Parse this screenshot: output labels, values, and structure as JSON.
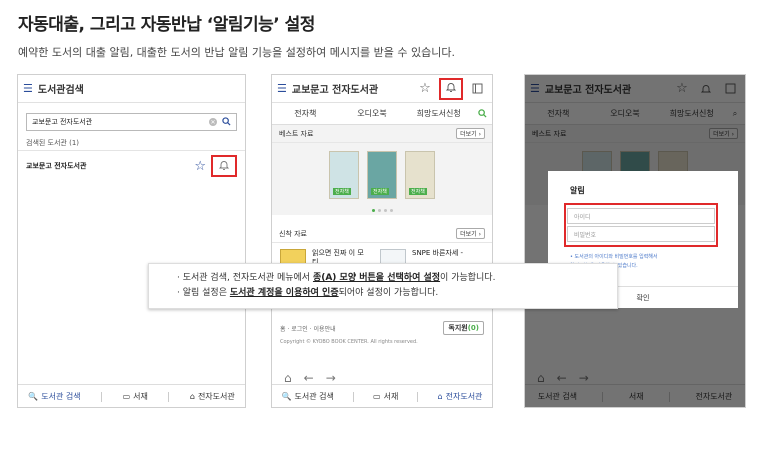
{
  "heading": {
    "title": "자동대출, 그리고 자동반납 ‘알림기능’ 설정",
    "subtitle": "예약한 도서의 대출 알림, 대출한 도서의 반납 알림 기능을 설정하여 메시지를 받을 수 있습니다."
  },
  "panel1": {
    "header_title": "도서관검색",
    "search_value": "교보문고 전자도서관",
    "searched_label": "검색된 도서관 (1)",
    "library_name": "교보문고 전자도서관"
  },
  "panel2": {
    "header_title": "교보문고 전자도서관",
    "tabs": [
      "전자책",
      "오디오북",
      "희망도서신청"
    ],
    "best_label": "베스트 자료",
    "new_label": "신착 자료",
    "more_label": "더보기 ›",
    "ebook_tag": "전자책",
    "new_book1": "읽으면 진짜 이 모티...",
    "new_book2": "SNPE 바른자세 -",
    "home_login": "홈 · 로그인 · 이용안내",
    "support_label": "독지원",
    "support_suffix": "(0)",
    "copyright": "Copyright © KYOBO BOOK CENTER. All rights reserved."
  },
  "panel3": {
    "dialog_title": "알림",
    "id_placeholder": "아이디",
    "pw_placeholder": "비밀번호",
    "dialog_note": "• 도서관의 아이디와 비밀번호를 입력해서",
    "dialog_note2": "   알림 기능을 사용할 수 있습니다.",
    "confirm_label": "확인"
  },
  "footer": {
    "search_label": "도서관 검색",
    "library_label": "서재",
    "ebook_library_label": "전자도서관"
  },
  "callout": {
    "line1_prefix": "· 도서관 검색, 전자도서관 메뉴에서 ",
    "line1_bold": "종(A) 모양 버튼을 선택하여 설정",
    "line1_suffix": "이 가능합니다.",
    "line2_prefix": "· 알림 설정은 ",
    "line2_bold": "도서관 계정을 이용하여 인증",
    "line2_suffix": "되어야 설정이 가능합니다."
  },
  "colors": {
    "highlight": "#e0292a",
    "accent_blue": "#2b4d9b",
    "accent_green": "#4cae4c"
  }
}
